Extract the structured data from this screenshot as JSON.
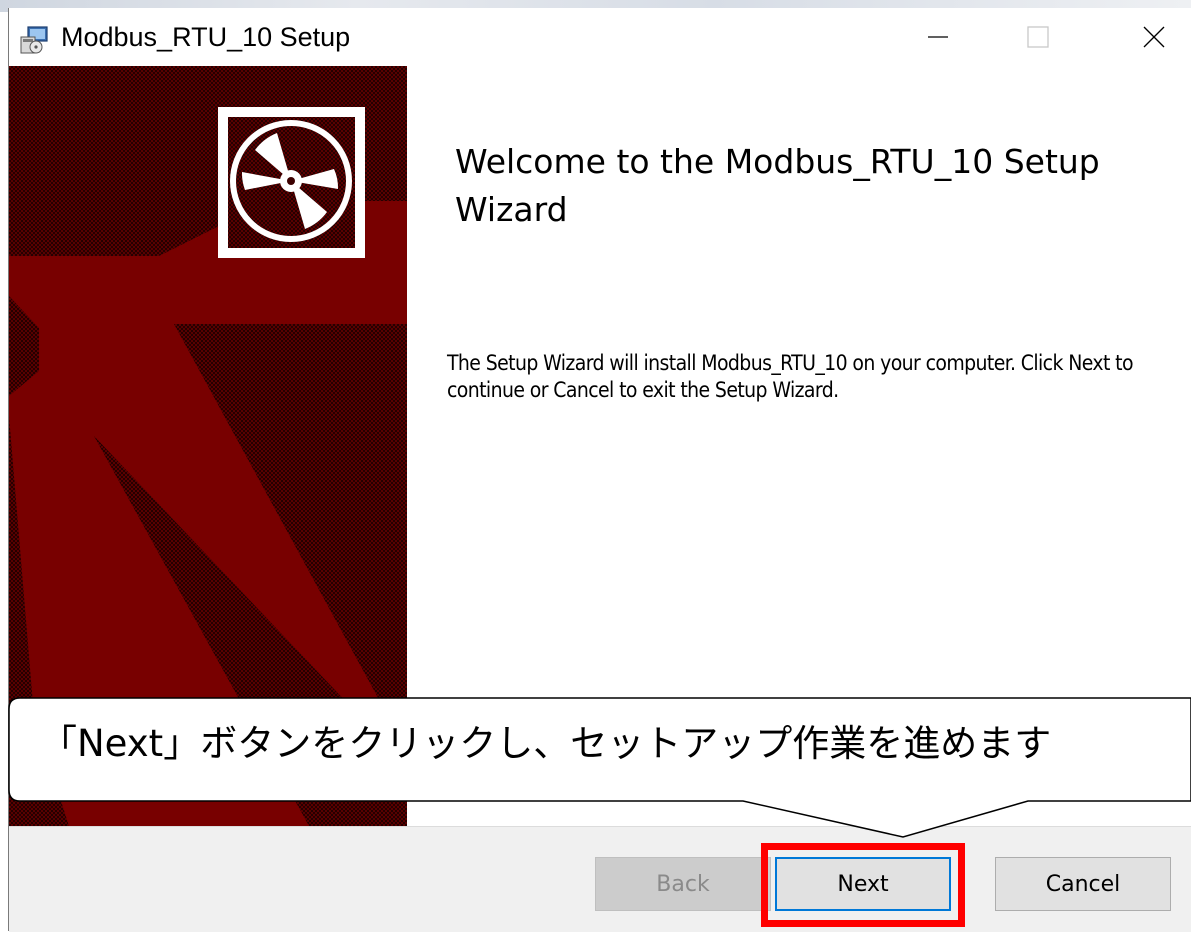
{
  "window": {
    "title": "Modbus_RTU_10 Setup",
    "controls": {
      "minimize": "minimize-icon",
      "maximize": "maximize-icon",
      "close": "close-icon"
    }
  },
  "banner": {
    "icon": "cd-disc-icon",
    "colors": {
      "dark": "#3c0000",
      "red": "#7a0000"
    }
  },
  "content": {
    "heading": "Welcome to the Modbus_RTU_10 Setup Wizard",
    "body": "The Setup Wizard will install Modbus_RTU_10 on your computer. Click Next to continue or Cancel to exit the Setup Wizard."
  },
  "buttons": {
    "back": {
      "label": "Back",
      "enabled": false
    },
    "next": {
      "label": "Next",
      "focused": true
    },
    "cancel": {
      "label": "Cancel"
    }
  },
  "annotation": {
    "callout_text": "「Next」ボタンをクリックし、セットアップ作業を進めます",
    "highlight_color": "#ff0000"
  },
  "colors": {
    "focus_border": "#0078d7",
    "bottom_bar": "#f0f0f0"
  }
}
